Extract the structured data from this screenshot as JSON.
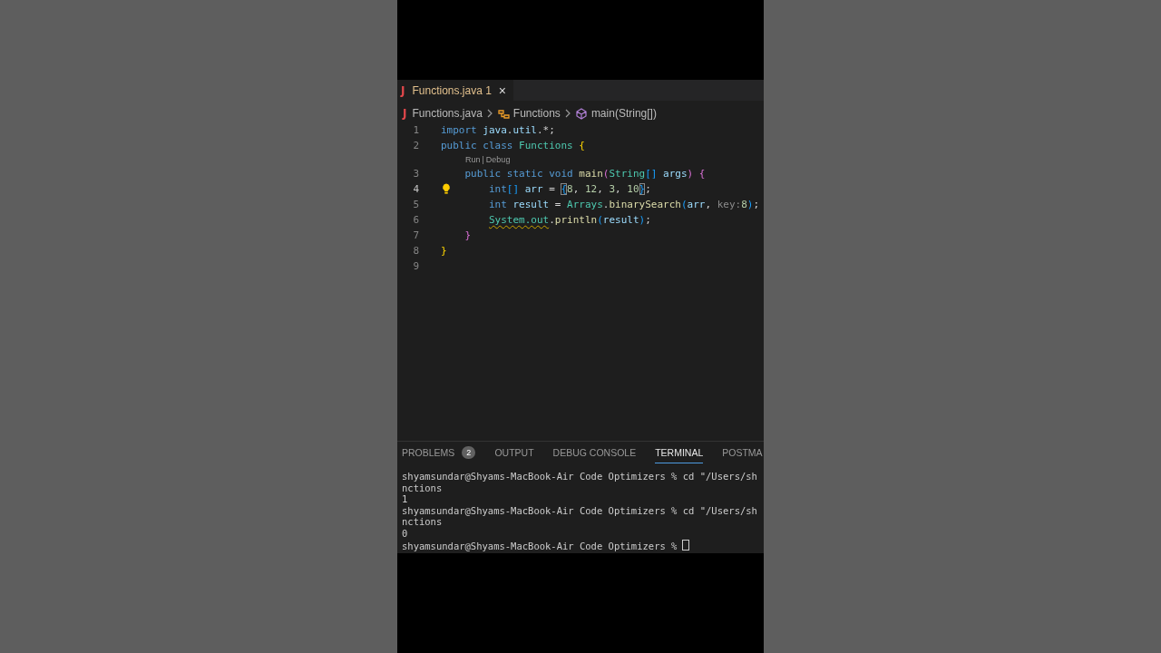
{
  "tab": {
    "icon": "J",
    "label": "Functions.java",
    "problems": "1",
    "close": "×"
  },
  "breadcrumbs": [
    {
      "kind": "file",
      "icon": "J",
      "label": "Functions.java"
    },
    {
      "kind": "class",
      "label": "Functions"
    },
    {
      "kind": "method",
      "label": "main(String[])"
    }
  ],
  "code": [
    {
      "kind": "line",
      "number": "1",
      "active": false,
      "lightbulb": false,
      "tokens": [
        {
          "text": "import ",
          "kind": "kw"
        },
        {
          "text": "java",
          "kind": "var"
        },
        {
          "text": ".",
          "kind": "pl"
        },
        {
          "text": "util",
          "kind": "var"
        },
        {
          "text": ".*;",
          "kind": "pl"
        }
      ]
    },
    {
      "kind": "line",
      "number": "2",
      "active": false,
      "lightbulb": false,
      "tokens": [
        {
          "text": "public class ",
          "kind": "kw"
        },
        {
          "text": "Functions ",
          "kind": "type"
        },
        {
          "text": "{",
          "kind": "b1"
        }
      ]
    },
    {
      "kind": "codelens",
      "links": [
        "Run",
        "Debug"
      ],
      "separator": "|"
    },
    {
      "kind": "line",
      "number": "3",
      "active": false,
      "lightbulb": false,
      "tokens": [
        {
          "text": "    public static void ",
          "kind": "kw"
        },
        {
          "text": "main",
          "kind": "func"
        },
        {
          "text": "(",
          "kind": "b2"
        },
        {
          "text": "String",
          "kind": "type"
        },
        {
          "text": "[] ",
          "kind": "b3"
        },
        {
          "text": "args",
          "kind": "var"
        },
        {
          "text": ") ",
          "kind": "b2"
        },
        {
          "text": "{",
          "kind": "b2"
        }
      ]
    },
    {
      "kind": "line",
      "number": "4",
      "active": true,
      "lightbulb": true,
      "tokens": [
        {
          "text": "        int",
          "kind": "kw"
        },
        {
          "text": "[] ",
          "kind": "b3"
        },
        {
          "text": "arr",
          "kind": "var"
        },
        {
          "text": " = ",
          "kind": "pl"
        },
        {
          "text": "{",
          "kind": "match"
        },
        {
          "text": "8",
          "kind": "num"
        },
        {
          "text": ", ",
          "kind": "pl"
        },
        {
          "text": "12",
          "kind": "num"
        },
        {
          "text": ", ",
          "kind": "pl"
        },
        {
          "text": "3",
          "kind": "num"
        },
        {
          "text": ", ",
          "kind": "pl"
        },
        {
          "text": "10",
          "kind": "num"
        },
        {
          "text": "}",
          "kind": "match"
        },
        {
          "text": ";",
          "kind": "pl"
        }
      ]
    },
    {
      "kind": "line",
      "number": "5",
      "active": false,
      "lightbulb": false,
      "tokens": [
        {
          "text": "        int ",
          "kind": "kw"
        },
        {
          "text": "result",
          "kind": "var"
        },
        {
          "text": " = ",
          "kind": "pl"
        },
        {
          "text": "Arrays",
          "kind": "type"
        },
        {
          "text": ".",
          "kind": "pl"
        },
        {
          "text": "binarySearch",
          "kind": "func"
        },
        {
          "text": "(",
          "kind": "b3"
        },
        {
          "text": "arr",
          "kind": "var"
        },
        {
          "text": ", ",
          "kind": "pl"
        },
        {
          "text": "key:",
          "kind": "hint"
        },
        {
          "text": "8",
          "kind": "num"
        },
        {
          "text": ")",
          "kind": "b3"
        },
        {
          "text": ";",
          "kind": "pl"
        }
      ]
    },
    {
      "kind": "line",
      "number": "6",
      "active": false,
      "lightbulb": false,
      "tokens": [
        {
          "text": "        System.out",
          "kind": "warn"
        },
        {
          "text": ".",
          "kind": "pl"
        },
        {
          "text": "println",
          "kind": "func"
        },
        {
          "text": "(",
          "kind": "b3"
        },
        {
          "text": "result",
          "kind": "var"
        },
        {
          "text": ")",
          "kind": "b3"
        },
        {
          "text": ";",
          "kind": "pl"
        }
      ]
    },
    {
      "kind": "line",
      "number": "7",
      "active": false,
      "lightbulb": false,
      "tokens": [
        {
          "text": "    }",
          "kind": "b2"
        }
      ]
    },
    {
      "kind": "line",
      "number": "8",
      "active": false,
      "lightbulb": false,
      "tokens": [
        {
          "text": "}",
          "kind": "b1"
        }
      ]
    },
    {
      "kind": "line",
      "number": "9",
      "active": false,
      "lightbulb": false
    }
  ],
  "panel": {
    "tabs": [
      {
        "label": "PROBLEMS",
        "badge": "2",
        "selected": false
      },
      {
        "label": "OUTPUT",
        "selected": false
      },
      {
        "label": "DEBUG CONSOLE",
        "selected": false
      },
      {
        "label": "TERMINAL",
        "selected": true
      },
      {
        "label": "POSTMA",
        "selected": false
      }
    ],
    "terminal": {
      "lines": [
        "shyamsundar@Shyams-MacBook-Air Code Optimizers % cd \"/Users/sh",
        "nctions",
        "1",
        "shyamsundar@Shyams-MacBook-Air Code Optimizers % cd \"/Users/sh",
        "nctions",
        "0",
        "shyamsundar@Shyams-MacBook-Air Code Optimizers %"
      ],
      "cursor": true
    }
  }
}
